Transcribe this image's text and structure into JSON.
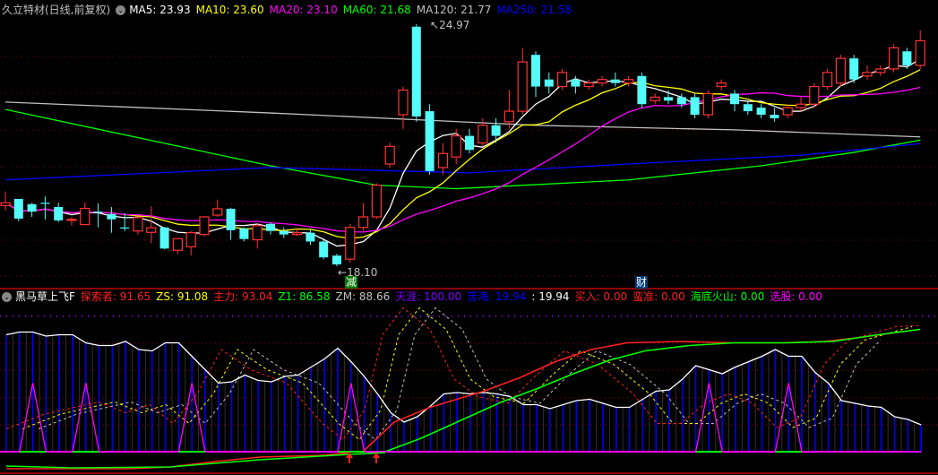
{
  "top_legend": {
    "title": "久立特材(日线,前复权)",
    "ma": [
      {
        "label": "MA5: 23.93",
        "color": "#ffffff"
      },
      {
        "label": "MA10: 23.60",
        "color": "#ffff00"
      },
      {
        "label": "MA20: 23.10",
        "color": "#ff00ff"
      },
      {
        "label": "MA60: 21.68",
        "color": "#00ff00"
      },
      {
        "label": "MA120: 21.77",
        "color": "#c0c0c0"
      },
      {
        "label": "MA250: 21.58",
        "color": "#0000ff"
      }
    ]
  },
  "price_labels": {
    "high": "24.97",
    "low": "18.10"
  },
  "markers": {
    "jian": "减",
    "cai": "财"
  },
  "bottom_legend": {
    "title": "黑马草上飞F",
    "items": [
      {
        "label": "探索者: 91.65",
        "color": "#ff2020"
      },
      {
        "label": "ZS: 91.08",
        "color": "#ffff00"
      },
      {
        "label": "主力: 93.04",
        "color": "#ff2020"
      },
      {
        "label": "Z1: 86.58",
        "color": "#00ff00"
      },
      {
        "label": "ZM: 88.66",
        "color": "#c0c0c0"
      },
      {
        "label": "天涯: 100.00",
        "color": "#8000ff"
      },
      {
        "label": "苦海: 19.94",
        "color": "#0000ff"
      },
      {
        "label": ": 19.94",
        "color": "#ffffff"
      },
      {
        "label": "买入: 0.00",
        "color": "#ff2020"
      },
      {
        "label": "蛮准: 0.00",
        "color": "#ff2020"
      },
      {
        "label": "海底火山: 0.00",
        "color": "#00ff00"
      },
      {
        "label": "选股: 0.00",
        "color": "#ff00ff"
      }
    ]
  },
  "colors": {
    "up": "#ff3232",
    "down": "#54fcfc",
    "grid": "#8b0000",
    "border": "#c00000"
  },
  "chart_data": [
    {
      "type": "candlestick",
      "title": "久立特材(日线,前复权)",
      "ylim": [
        18.1,
        24.97
      ],
      "candles_ohlc": [
        [
          19.82,
          19.9,
          20.22,
          19.67
        ],
        [
          20.01,
          19.45,
          20.01,
          19.37
        ],
        [
          19.86,
          19.65,
          19.9,
          19.5
        ],
        [
          19.9,
          19.88,
          20.08,
          19.42
        ],
        [
          19.78,
          19.4,
          19.9,
          19.35
        ],
        [
          19.41,
          19.43,
          19.5,
          19.25
        ],
        [
          19.28,
          19.74,
          19.9,
          19.28
        ],
        [
          19.65,
          19.62,
          19.88,
          19.2
        ],
        [
          19.58,
          19.43,
          19.78,
          19.05
        ],
        [
          19.2,
          19.17,
          19.6,
          19.1
        ],
        [
          19.1,
          19.48,
          19.48,
          19.0
        ],
        [
          19.06,
          19.19,
          19.8,
          18.75
        ],
        [
          19.2,
          18.6,
          19.22,
          18.58
        ],
        [
          18.55,
          18.88,
          18.9,
          18.45
        ],
        [
          18.65,
          19.05,
          19.1,
          18.4
        ],
        [
          19.0,
          19.5,
          19.52,
          18.95
        ],
        [
          19.55,
          19.73,
          19.99,
          19.5
        ],
        [
          19.73,
          19.12,
          19.76,
          18.85
        ],
        [
          19.17,
          18.87,
          19.2,
          18.8
        ],
        [
          18.85,
          19.25,
          19.3,
          18.6
        ],
        [
          19.3,
          19.1,
          19.35,
          19.0
        ],
        [
          19.1,
          19.0,
          19.2,
          18.9
        ],
        [
          19.0,
          19.05,
          19.15,
          18.95
        ],
        [
          19.05,
          18.8,
          19.15,
          18.7
        ],
        [
          18.8,
          18.35,
          18.85,
          18.3
        ],
        [
          18.4,
          18.15,
          18.45,
          18.1
        ],
        [
          18.3,
          19.2,
          19.3,
          18.2
        ],
        [
          19.2,
          19.5,
          19.9,
          19.1
        ],
        [
          19.5,
          20.4,
          20.45,
          19.45
        ],
        [
          21.0,
          21.5,
          21.6,
          20.9
        ],
        [
          22.4,
          23.1,
          23.2,
          22.0
        ],
        [
          24.9,
          22.35,
          24.97,
          22.2
        ],
        [
          22.5,
          20.8,
          22.7,
          20.7
        ],
        [
          20.9,
          21.3,
          21.6,
          20.7
        ],
        [
          21.2,
          21.8,
          22.0,
          21.0
        ],
        [
          21.8,
          21.4,
          22.0,
          21.3
        ],
        [
          21.6,
          22.1,
          22.3,
          21.5
        ],
        [
          22.1,
          21.8,
          22.3,
          21.6
        ],
        [
          22.2,
          22.5,
          23.1,
          22.0
        ],
        [
          22.5,
          23.9,
          24.3,
          22.4
        ],
        [
          24.1,
          23.2,
          24.2,
          22.9
        ],
        [
          23.4,
          23.2,
          23.6,
          23.0
        ],
        [
          23.2,
          23.6,
          23.7,
          23.1
        ],
        [
          23.4,
          23.2,
          23.5,
          23.0
        ],
        [
          23.2,
          23.3,
          23.4,
          23.1
        ],
        [
          23.3,
          23.4,
          23.5,
          23.2
        ],
        [
          23.4,
          23.3,
          23.6,
          23.2
        ],
        [
          23.3,
          23.4,
          23.5,
          23.2
        ],
        [
          23.5,
          22.7,
          23.6,
          22.6
        ],
        [
          22.8,
          22.9,
          23.0,
          22.7
        ],
        [
          22.9,
          22.8,
          23.1,
          22.7
        ],
        [
          22.9,
          22.7,
          23.0,
          22.6
        ],
        [
          22.9,
          22.4,
          23.0,
          22.3
        ],
        [
          22.4,
          23.0,
          23.1,
          22.3
        ],
        [
          23.2,
          23.3,
          23.4,
          23.1
        ],
        [
          23.0,
          22.7,
          23.1,
          22.5
        ],
        [
          22.7,
          22.5,
          22.8,
          22.4
        ],
        [
          22.6,
          22.4,
          22.7,
          22.3
        ],
        [
          22.4,
          22.3,
          22.6,
          22.2
        ],
        [
          22.4,
          22.6,
          22.7,
          22.3
        ],
        [
          22.6,
          22.7,
          22.9,
          22.5
        ],
        [
          22.7,
          23.2,
          23.3,
          22.6
        ],
        [
          23.2,
          23.6,
          23.7,
          23.1
        ],
        [
          23.3,
          24.0,
          24.1,
          23.2
        ],
        [
          24.0,
          23.4,
          24.1,
          23.3
        ],
        [
          23.5,
          23.6,
          23.8,
          23.4
        ],
        [
          23.6,
          23.7,
          23.8,
          23.5
        ],
        [
          23.7,
          24.3,
          24.4,
          23.6
        ],
        [
          24.2,
          23.8,
          24.3,
          23.7
        ],
        [
          23.8,
          24.5,
          24.8,
          23.7
        ]
      ],
      "ma_computed": [
        {
          "name": "MA5",
          "period": 5,
          "color": "#ffffff"
        },
        {
          "name": "MA10",
          "period": 10,
          "color": "#ffff00"
        },
        {
          "name": "MA20",
          "period": 20,
          "color": "#ff00ff"
        }
      ],
      "ma_anchors": [
        {
          "name": "MA60",
          "color": "#00ff00",
          "points": [
            [
              0,
              22.55
            ],
            [
              20,
              20.95
            ],
            [
              28,
              20.4
            ],
            [
              34,
              20.3
            ],
            [
              47,
              20.55
            ],
            [
              57,
              20.95
            ],
            [
              64,
              21.33
            ],
            [
              69,
              21.68
            ]
          ]
        },
        {
          "name": "MA120",
          "color": "#c0c0c0",
          "points": [
            [
              0,
              22.76
            ],
            [
              20,
              22.45
            ],
            [
              40,
              22.1
            ],
            [
              55,
              21.97
            ],
            [
              69,
              21.77
            ]
          ]
        },
        {
          "name": "MA250",
          "color": "#0000ff",
          "points": [
            [
              0,
              20.55
            ],
            [
              20,
              20.9
            ],
            [
              35,
              20.75
            ],
            [
              47,
              21.0
            ],
            [
              60,
              21.25
            ],
            [
              69,
              21.58
            ]
          ]
        }
      ]
    },
    {
      "type": "line",
      "title": "黑马草上飞F",
      "ylim": [
        0,
        100
      ],
      "white_line": [
        87,
        89,
        89,
        86,
        87,
        87,
        81,
        79,
        79,
        82,
        76,
        75,
        81,
        81,
        71,
        61,
        51,
        52,
        57,
        53,
        52,
        56,
        57,
        63,
        69,
        77,
        67,
        56,
        43,
        29,
        22,
        26,
        34,
        43,
        44,
        43,
        44,
        43,
        41,
        35,
        35,
        32,
        35,
        38,
        39,
        36,
        33,
        33,
        39,
        45,
        46,
        54,
        64,
        61,
        58,
        63,
        67,
        71,
        76,
        71,
        71,
        59,
        51,
        38,
        36,
        34,
        33,
        26,
        24,
        20
      ],
      "spikes_index": [
        2,
        6,
        14,
        26,
        53,
        59
      ],
      "spike_value": 51,
      "dashed_red": [
        [
          7,
          17
        ],
        [
          50,
          28
        ],
        [
          110,
          37
        ],
        [
          140,
          29
        ],
        [
          167,
          35
        ],
        [
          193,
          21
        ],
        [
          220,
          43
        ],
        [
          247,
          76
        ],
        [
          280,
          61
        ],
        [
          320,
          51
        ],
        [
          360,
          21
        ],
        [
          383,
          9
        ],
        [
          407,
          31
        ],
        [
          427,
          87
        ],
        [
          450,
          107
        ],
        [
          480,
          91
        ],
        [
          507,
          54
        ],
        [
          533,
          41
        ],
        [
          567,
          36
        ],
        [
          600,
          58
        ],
        [
          630,
          75
        ],
        [
          667,
          65
        ],
        [
          707,
          43
        ],
        [
          733,
          21
        ],
        [
          760,
          21
        ],
        [
          787,
          36
        ],
        [
          813,
          43
        ],
        [
          840,
          36
        ],
        [
          867,
          18
        ],
        [
          893,
          25
        ],
        [
          920,
          65
        ],
        [
          947,
          83
        ],
        [
          1000,
          93
        ],
        [
          1027,
          94
        ]
      ],
      "dashed_lag": {
        "yellow": 18,
        "gray": 36
      },
      "red_line": [
        [
          405,
          0
        ],
        [
          440,
          22
        ],
        [
          480,
          33
        ],
        [
          540,
          45
        ],
        [
          580,
          55
        ],
        [
          620,
          67
        ],
        [
          660,
          76
        ],
        [
          700,
          81
        ],
        [
          760,
          82
        ],
        [
          820,
          81
        ],
        [
          870,
          81
        ],
        [
          920,
          82
        ],
        [
          960,
          85
        ],
        [
          1027,
          91
        ]
      ],
      "green_line": [
        [
          430,
          0
        ],
        [
          470,
          10
        ],
        [
          520,
          25
        ],
        [
          560,
          37
        ],
        [
          600,
          47
        ],
        [
          640,
          58
        ],
        [
          680,
          68
        ],
        [
          720,
          75
        ],
        [
          770,
          79
        ],
        [
          820,
          81
        ],
        [
          880,
          81
        ],
        [
          930,
          82
        ],
        [
          980,
          87
        ],
        [
          1027,
          91
        ]
      ]
    }
  ]
}
